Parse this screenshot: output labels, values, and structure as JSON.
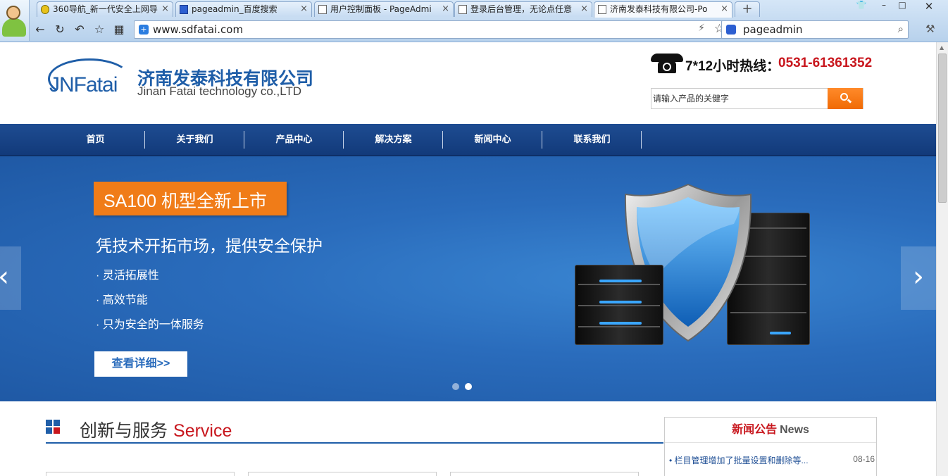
{
  "browser": {
    "tabs": [
      {
        "label": "360导航_新一代安全上网导",
        "icon": "360-icon"
      },
      {
        "label": "pageadmin_百度搜索",
        "icon": "baidu-paw-icon"
      },
      {
        "label": "用户控制面板 - PageAdmi",
        "icon": "page-icon"
      },
      {
        "label": "登录后台管理，无论点任意",
        "icon": "page-icon"
      },
      {
        "label": "济南发泰科技有限公司-Po",
        "icon": "page-icon",
        "active": true
      }
    ],
    "new_tab": "+",
    "close_glyph": "×",
    "url": "www.sdfatai.com",
    "search_query": "pageadmin"
  },
  "site": {
    "logo_text": "JNFatai",
    "company_name_cn": "济南发泰科技有限公司",
    "company_name_en": "Jinan Fatai technology co.,LTD",
    "hotline_label": "7*12小时热线：",
    "hotline_number": "0531-61361352",
    "search_placeholder": "请输入产品的关健字",
    "nav": [
      "首页",
      "关于我们",
      "产品中心",
      "解决方案",
      "新闻中心",
      "联系我们"
    ],
    "banner": {
      "tagline": "SA100 机型全新上市",
      "slogan": "凭技术开拓市场，提供安全保护",
      "features": [
        "· 灵活拓展性",
        "· 高效节能",
        "· 只为安全的一体服务"
      ],
      "detail_button": "查看详细>>",
      "prev_arrow": "‹",
      "next_arrow": "›",
      "slide_count": 2,
      "active_slide": 2
    },
    "service": {
      "title_cn": "创新与服务",
      "title_en": "Service"
    },
    "news": {
      "title_cn": "新闻公告",
      "title_en": "News",
      "items": [
        {
          "bullet": "•",
          "title": "栏目管理增加了批量设置和删除等...",
          "date": "08-16"
        }
      ]
    }
  },
  "colors": {
    "brand_blue": "#1f5ea8",
    "accent_orange": "#f07c18",
    "hotline_red": "#c8161d",
    "nav_blue": "#1a4589"
  }
}
